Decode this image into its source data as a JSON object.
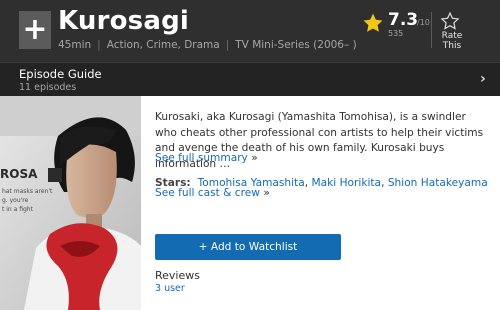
{
  "header": {
    "add_symbol": "+",
    "title": "Kurosagi",
    "duration": "45min",
    "genres": "Action, Crime, Drama",
    "type": "TV Mini-Series (2006– )",
    "separator": "|"
  },
  "rating": {
    "value": "7.3",
    "max": "/10",
    "count": "535",
    "icon": "star-icon"
  },
  "rate_this": {
    "label_line1": "Rate",
    "label_line2": "This",
    "icon": "outline-star-icon"
  },
  "episode_guide": {
    "title": "Episode Guide",
    "count": "11 episodes",
    "chevron": "›"
  },
  "poster": {
    "text_fragments": [
      "ROSA",
      "hat masks aren't",
      "g. you're",
      "t in a fight"
    ]
  },
  "summary": {
    "text": "Kurosaki, aka Kurosagi (Yamashita Tomohisa), is a swindler who cheats other professional con artists to help their victims and avenge the death of his own family. Kurosaki buys information …",
    "see_full_label": "See full summary",
    "arrow": "»"
  },
  "stars": {
    "label": "Stars:",
    "names": [
      "Tomohisa Yamashita",
      "Maki Horikita",
      "Shion Hatakeyama"
    ],
    "separator": ",",
    "see_cast_label": "See full cast & crew",
    "arrow": "»"
  },
  "watchlist": {
    "label": "+  Add to Watchlist"
  },
  "reviews": {
    "title": "Reviews",
    "count": "3 user"
  },
  "colors": {
    "header_bg": "#2f2f2f",
    "guide_bg": "#232323",
    "accent": "#136cb2",
    "star": "#f5c518"
  }
}
